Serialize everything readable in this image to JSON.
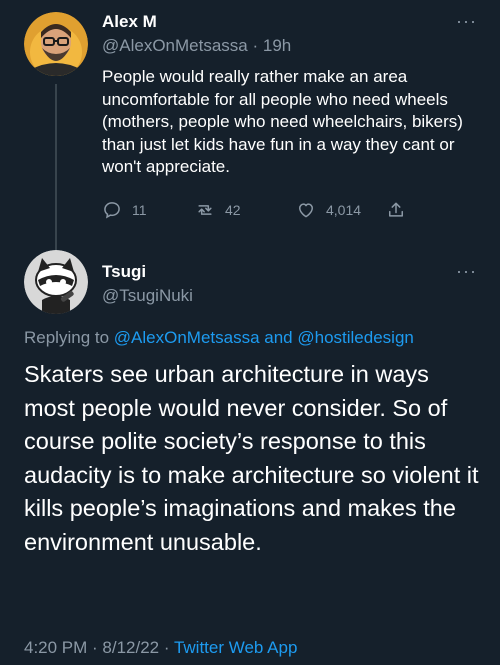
{
  "tweet1": {
    "name": "Alex M",
    "handle_time": "@AlexOnMetsassa · 19h",
    "text": "People would really rather make an area uncomfortable for all people who need wheels (mothers, people who need wheelchairs, bikers) than just let kids have fun in a way they cant or won't appreciate.",
    "replies": "11",
    "retweets": "42",
    "likes": "4,014"
  },
  "tweet2": {
    "name": "Tsugi",
    "handle": "@TsugiNuki",
    "replying_prefix": "Replying to ",
    "reply_to_1": "@AlexOnMetsassa",
    "reply_and": " and ",
    "reply_to_2": "@hostiledesign",
    "text": "Skaters see urban architecture in ways most people would never consider. So of course polite society’s response to this audacity is to make architecture so violent it kills people’s imaginations and makes the environment unusable.",
    "time_date": "4:20 PM · 8/12/22 · ",
    "source": "Twitter Web App"
  }
}
